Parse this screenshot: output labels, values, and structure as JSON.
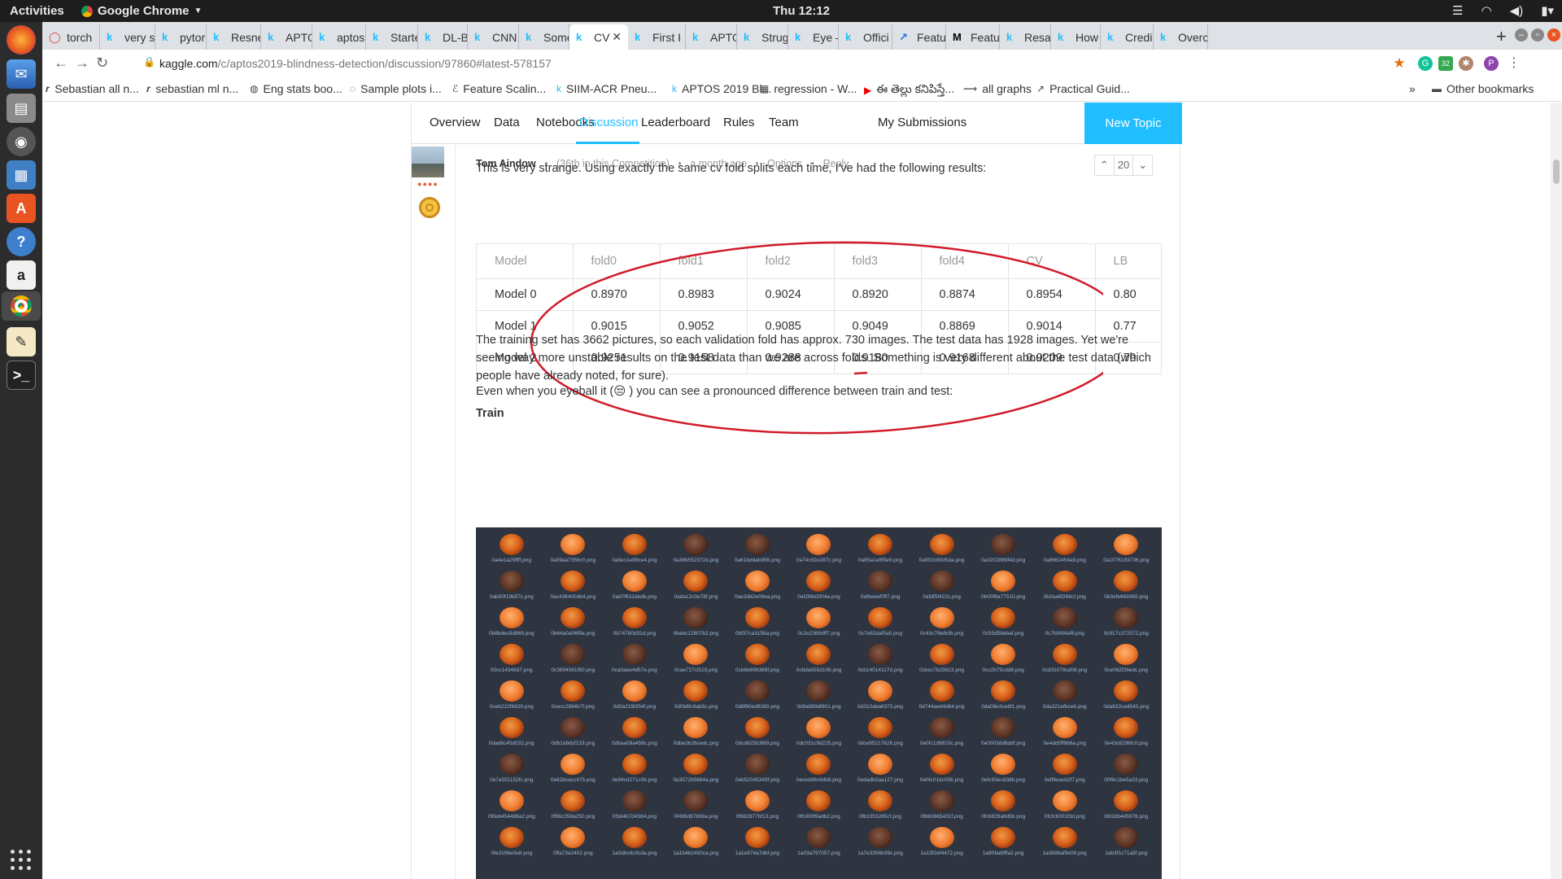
{
  "topbar": {
    "activities": "Activities",
    "app_menu": "Google Chrome",
    "clock": "Thu 12:12"
  },
  "browser": {
    "tabs": [
      {
        "label": "torch",
        "favicon": "github-icon"
      },
      {
        "label": "very s",
        "favicon": "kaggle-icon"
      },
      {
        "label": "pytor",
        "favicon": "kaggle-icon"
      },
      {
        "label": "Resne",
        "favicon": "kaggle-icon"
      },
      {
        "label": "APTO",
        "favicon": "kaggle-icon"
      },
      {
        "label": "aptos",
        "favicon": "kaggle-icon"
      },
      {
        "label": "Starte",
        "favicon": "kaggle-icon"
      },
      {
        "label": "DL-Bl",
        "favicon": "kaggle-icon"
      },
      {
        "label": "CNN /",
        "favicon": "kaggle-icon"
      },
      {
        "label": "Some",
        "favicon": "kaggle-icon"
      },
      {
        "label": "CV",
        "favicon": "kaggle-icon",
        "active": true
      },
      {
        "label": "First I",
        "favicon": "kaggle-icon"
      },
      {
        "label": "APTO",
        "favicon": "kaggle-icon"
      },
      {
        "label": "Strug",
        "favicon": "kaggle-icon"
      },
      {
        "label": "Eye –",
        "favicon": "kaggle-icon"
      },
      {
        "label": "Offici",
        "favicon": "kaggle-icon"
      },
      {
        "label": "Featu",
        "favicon": "chart-icon"
      },
      {
        "label": "Featu",
        "favicon": "medium-icon"
      },
      {
        "label": "Resar",
        "favicon": "kaggle-icon"
      },
      {
        "label": "How",
        "favicon": "kaggle-icon"
      },
      {
        "label": "Credi",
        "favicon": "kaggle-icon"
      },
      {
        "label": "Overc",
        "favicon": "kaggle-icon"
      }
    ],
    "url_host": "kaggle.com",
    "url_path": "/c/aptos2019-blindness-detection/discussion/97860#latest-578157",
    "extension_badge": "32",
    "profile_initial": "P",
    "bookmarks": [
      "Sebastian all n...",
      "sebastian ml n...",
      "Eng stats boo...",
      "Sample plots i...",
      "Feature Scalin...",
      "SIIM-ACR Pneu...",
      "APTOS 2019 Bl...",
      "regression - W...",
      "ఈ తెల్లు కనిపిస్తే...",
      "all graphs",
      "Practical Guid..."
    ],
    "bookmarks_overflow": "»",
    "other_bookmarks": "Other bookmarks"
  },
  "competition_nav": {
    "items": [
      "Overview",
      "Data",
      "Notebooks",
      "Discussion",
      "Leaderboard",
      "Rules",
      "Team"
    ],
    "active": "Discussion",
    "my_submissions": "My Submissions",
    "new_topic": "New Topic"
  },
  "post": {
    "author": "Tom Aindow",
    "rank": "(36th in this Competition)",
    "time": "a month ago",
    "options": "Options",
    "reply": "Reply",
    "votes": "20",
    "intro": "This is very strange. Using exactly the same cv fold splits each time, I've had the following results:",
    "table": {
      "headers": [
        "Model",
        "fold0",
        "fold1",
        "fold2",
        "fold3",
        "fold4",
        "CV",
        "LB"
      ],
      "rows": [
        [
          "Model 0",
          "0.8970",
          "0.8983",
          "0.9024",
          "0.8920",
          "0.8874",
          "0.8954",
          "0.80"
        ],
        [
          "Model 1",
          "0.9015",
          "0.9052",
          "0.9085",
          "0.9049",
          "0.8869",
          "0.9014",
          "0.77"
        ],
        [
          "Model 2",
          "0.9251",
          "0.9158",
          "0.9288",
          "0.9180",
          "0.9168",
          "0.9209",
          "0.79"
        ]
      ]
    },
    "paragraph2": "The training set has 3662 pictures, so each validation fold has approx. 730 images. The test data has 1928 images. Yet we're seeing way more unstable results on the test data than we are across folds. Something is very different about the test data (which people have already noted, for sure).",
    "paragraph3_before": "Even when you eyeball it (",
    "paragraph3_emoji": "😒",
    "paragraph3_after": ") you can see a pronounced difference between train and test:",
    "train_heading": "Train",
    "train_files": [
      "0a4e1a29ffff.png",
      "0a09aa7356c0.png",
      "0a9ec1e99ce4.png",
      "0a38b552372d.png",
      "0a61bddab956.png",
      "0a74c92e287c.png",
      "0a85a1e8f9e9.png",
      "0a902c80d5da.png",
      "0a3202889f4d.png",
      "0a8662454a9.png",
      "0a1076183736.png",
      "0ab50f19b57c.png",
      "0ac436400db4.png",
      "0ad7f631dedb.png",
      "0ada12c0e78f.png",
      "0ae2dd2e09ea.png",
      "0af296d2f04a.png",
      "0afbeeef0ff7.png",
      "0afdf5f422c.png",
      "0b00f8a77510.png",
      "0b2ea8f268cf.png",
      "0b3efe669365.png",
      "0b8bdec9d869.png",
      "0b64a0a06f9a.png",
      "0b74780d31d.png",
      "0babc12807b2.png",
      "0bf37ca3156a.png",
      "0c2e2369dff7.png",
      "0c7e82daf5a0.png",
      "0c43c79e8cfb.png",
      "0c55d58ebaf.png",
      "0c7fd494af8.png",
      "0c917c372572.png",
      "00cc14348d7.png",
      "0c3894561f80.png",
      "0ca0aee4d57e.png",
      "0cae727cf119.png",
      "0cb6b898389f.png",
      "0cbda555d108.png",
      "0cb14014117d.png",
      "0cbcc7b23613.png",
      "0cc2b75cdd8.png",
      "0cd31078cd08.png",
      "0ce062f26edc.png",
      "0ceb222f6629.png",
      "0cecc2864b7f.png",
      "0d0a21f8354f.png",
      "0d0b8fc9ab5c.png",
      "0d8f60ed9280.png",
      "0d9a989df801.png",
      "0d310aba6373.png",
      "0d744aed4d64.png",
      "0da09e3ce8f1.png",
      "0da321efbce6.png",
      "0da632ca4540.png",
      "0dad6c45d032.png",
      "0db1d8dcf219.png",
      "0dbaa09a458c.png",
      "0dbe2b26cedc.png",
      "0dcd825b3f69.png",
      "0dc031c9d225.png",
      "0dce95217626.png",
      "0e0fc1d9810c.png",
      "0e0003dd8ddf.png",
      "0e4dd0ff9b6a.png",
      "0e43c8298fc0.png",
      "0e7a551152fc.png",
      "0e82bcacc475.png",
      "0e94cd271c0b.png",
      "0e3572b5884a.png",
      "0eb52045349f.png",
      "0eced86c9db8.png",
      "0edadb2aa127.png",
      "0ef4c01dc056.png",
      "0efc93ec838b.png",
      "0eff8eacb2f7.png",
      "00f6c1be5a33.png",
      "0f0eb454466a2.png",
      "0f96c358a250.png",
      "0f3d4b7d4384.png",
      "0f495d87656a.png",
      "0f882877bf13.png",
      "0fb300f9adb2.png",
      "0fb1053285cf.png",
      "0fbb0665431f.png",
      "0fc6829a8d5b.png",
      "0fcfc6301f3d.png",
      "0fd18b445976.png",
      "0fe3196e0e8.png",
      "0ffa73e2402.png",
      "1a0dbc6c0cda.png",
      "1a1b4b2450ca.png",
      "1a1e974a7dbf.png",
      "1a03a797057.png",
      "1a7e3356b39c.png",
      "1a19f2ef4472.png",
      "1a90fad9ffa2.png",
      "1a369baf9e06.png",
      "1ab3f1c71a5f.png"
    ]
  },
  "colors": {
    "accent": "#20beff",
    "annotation": "#d11b2a",
    "dock_bg": "#2c2c2c",
    "topbar_bg": "#1d1d1d",
    "grid_bg": "#2e3440"
  }
}
